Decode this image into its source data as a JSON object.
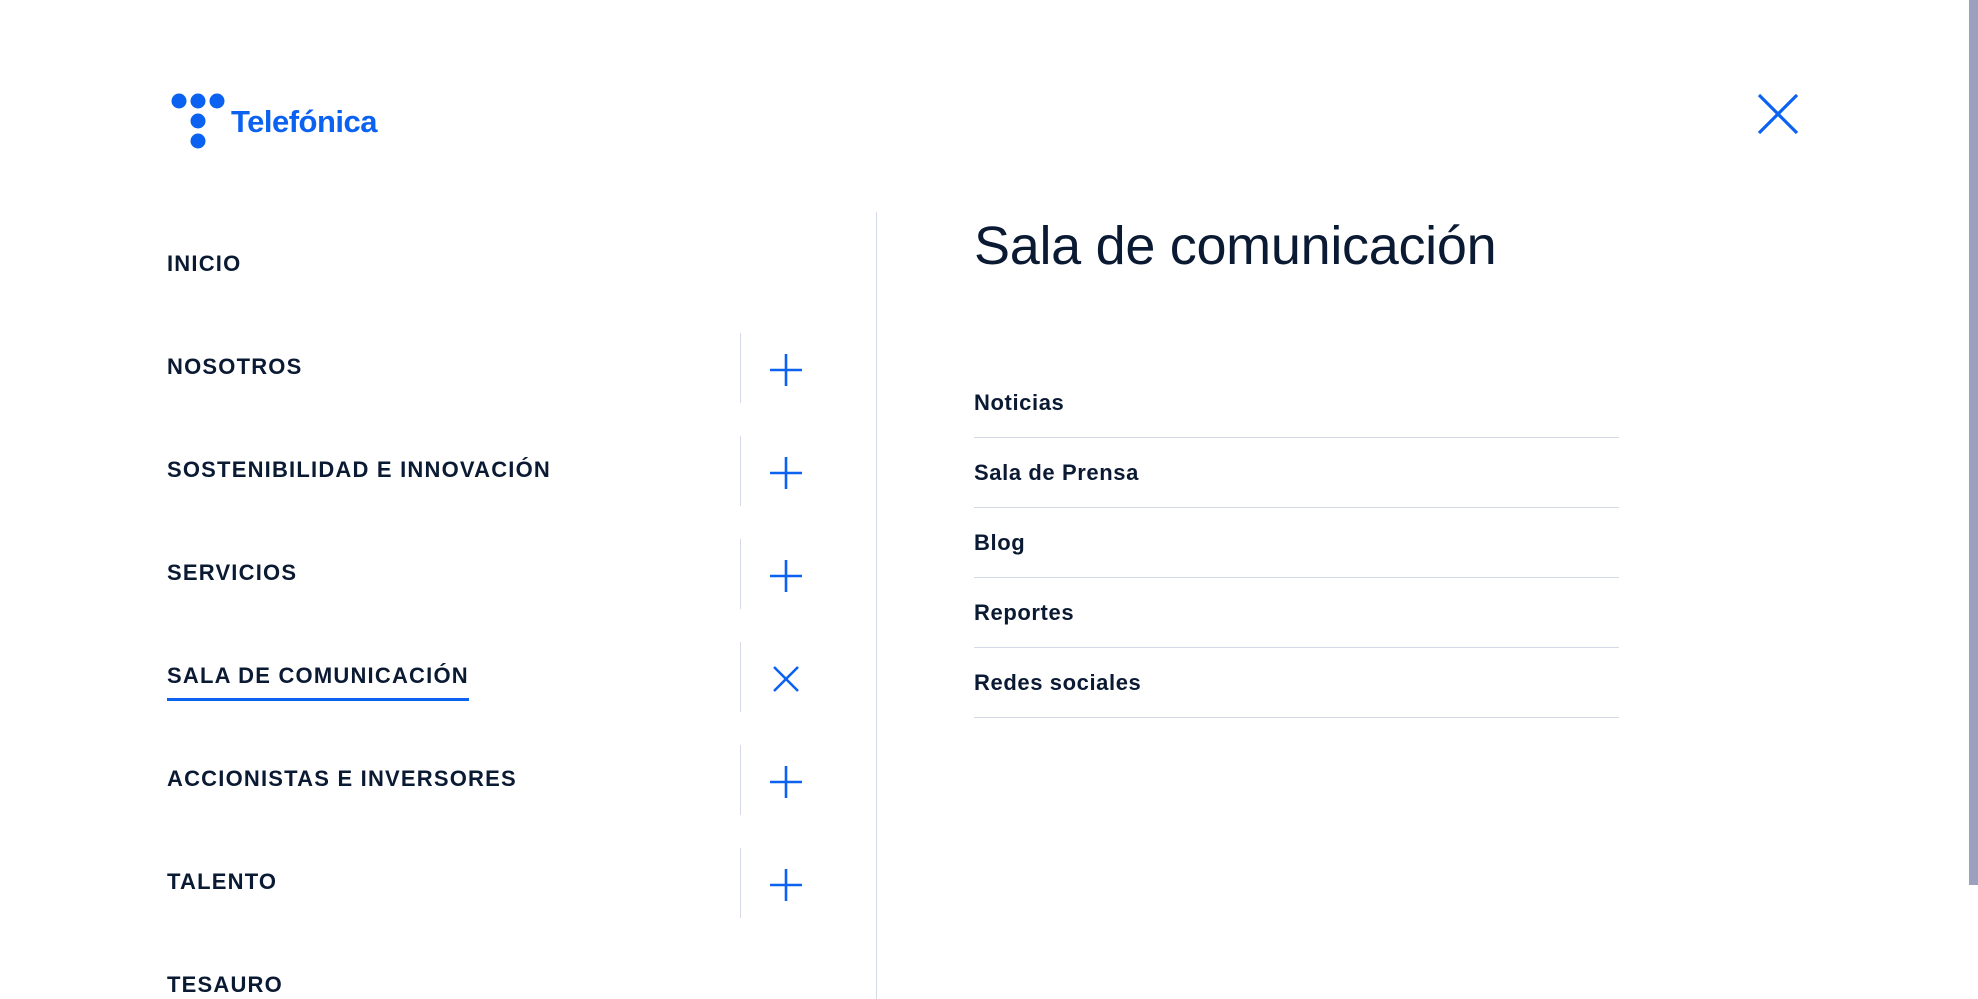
{
  "brand": {
    "name": "Telefónica",
    "color": "#0b62f0"
  },
  "close_icon": "close-icon",
  "nav": {
    "items": [
      {
        "label": "INICIO",
        "toggle": "none"
      },
      {
        "label": "NOSOTROS",
        "toggle": "plus"
      },
      {
        "label": "SOSTENIBILIDAD E INNOVACIÓN",
        "toggle": "plus"
      },
      {
        "label": "SERVICIOS",
        "toggle": "plus"
      },
      {
        "label": "SALA DE COMUNICACIÓN",
        "toggle": "close",
        "active": true
      },
      {
        "label": "ACCIONISTAS E INVERSORES",
        "toggle": "plus"
      },
      {
        "label": "TALENTO",
        "toggle": "plus"
      },
      {
        "label": "TESAURO",
        "toggle": "none"
      }
    ]
  },
  "panel": {
    "title": "Sala de comunicación",
    "links": [
      {
        "label": "Noticias"
      },
      {
        "label": "Sala de Prensa"
      },
      {
        "label": "Blog"
      },
      {
        "label": "Reportes"
      },
      {
        "label": "Redes sociales"
      }
    ]
  }
}
